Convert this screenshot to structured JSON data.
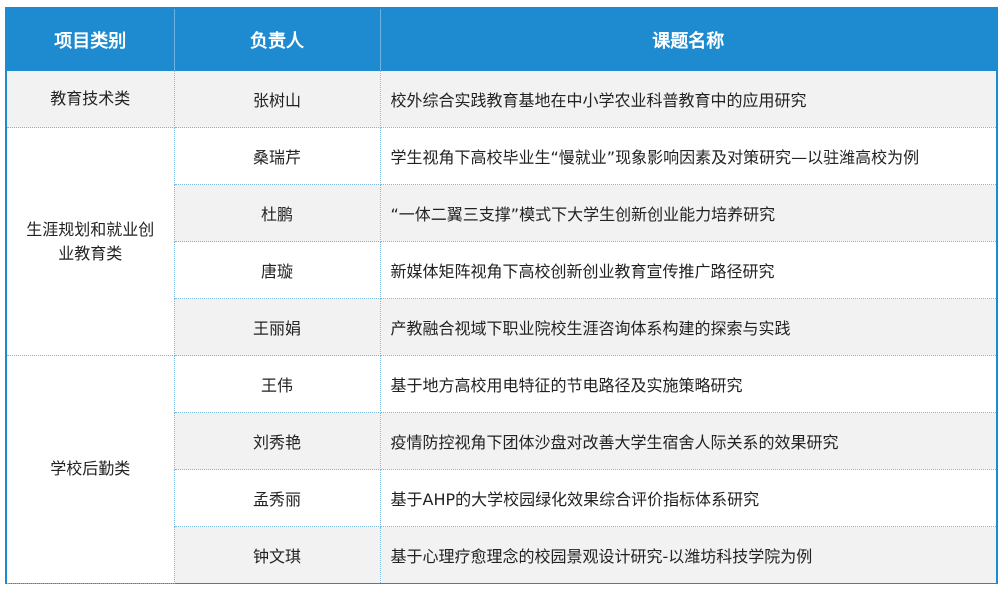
{
  "headers": {
    "category": "项目类别",
    "person": "负责人",
    "topic": "课题名称"
  },
  "groups": [
    {
      "category": "教育技术类",
      "rows": [
        {
          "person": "张树山",
          "topic": "校外综合实践教育基地在中小学农业科普教育中的应用研究"
        }
      ]
    },
    {
      "category": "生涯规划和就业创业教育类",
      "rows": [
        {
          "person": "桑瑞芹",
          "topic": "学生视角下高校毕业生“慢就业”现象影响因素及对策研究—以驻潍高校为例"
        },
        {
          "person": "杜鹏",
          "topic": "“一体二翼三支撑”模式下大学生创新创业能力培养研究"
        },
        {
          "person": "唐璇",
          "topic": "新媒体矩阵视角下高校创新创业教育宣传推广路径研究"
        },
        {
          "person": "王丽娟",
          "topic": "产教融合视域下职业院校生涯咨询体系构建的探索与实践"
        }
      ]
    },
    {
      "category": "学校后勤类",
      "rows": [
        {
          "person": "王伟",
          "topic": "基于地方高校用电特征的节电路径及实施策略研究"
        },
        {
          "person": "刘秀艳",
          "topic": "疫情防控视角下团体沙盘对改善大学生宿舍人际关系的效果研究"
        },
        {
          "person": "孟秀丽",
          "topic": "基于AHP的大学校园绿化效果综合评价指标体系研究"
        },
        {
          "person": "钟文琪",
          "topic": "基于心理疗愈理念的校园景观设计研究-以潍坊科技学院为例"
        }
      ]
    }
  ],
  "colors": {
    "header_bg": "#1e8ad0",
    "shade_bg": "#f2f2f2",
    "divider": "#7fb6dc"
  }
}
